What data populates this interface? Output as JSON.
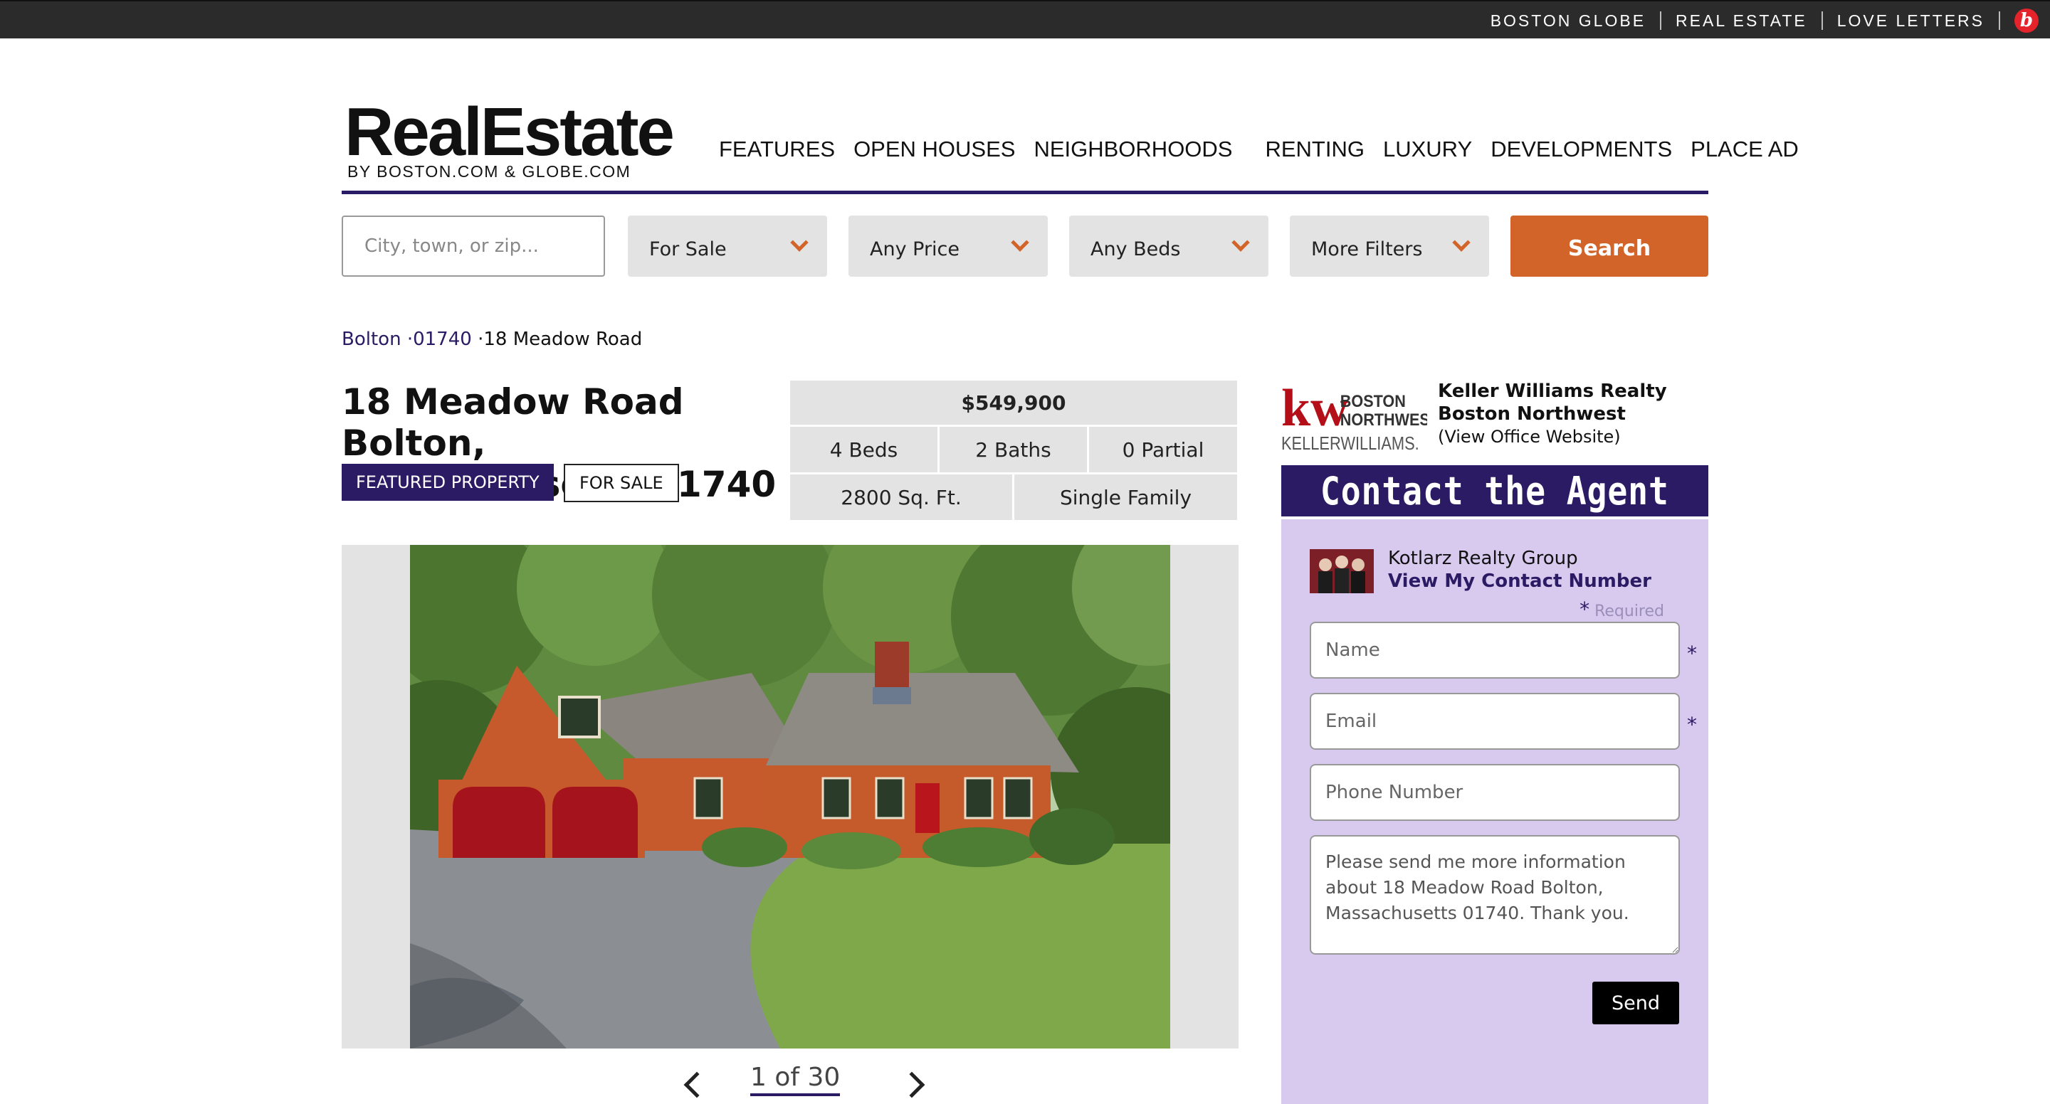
{
  "topbar": {
    "links": [
      "BOSTON GLOBE",
      "REAL ESTATE",
      "LOVE LETTERS"
    ],
    "brand_glyph": "b"
  },
  "header": {
    "logo_main": "RealEstate",
    "logo_sub": "BY BOSTON.COM & GLOBE.COM",
    "nav": [
      "FEATURES",
      "OPEN HOUSES",
      "NEIGHBORHOODS",
      "RENTING",
      "LUXURY",
      "DEVELOPMENTS",
      "PLACE AD"
    ]
  },
  "search": {
    "placeholder": "City, town, or zip...",
    "filters": [
      "For Sale",
      "Any Price",
      "Any Beds",
      "More Filters"
    ],
    "button": "Search"
  },
  "breadcrumb": {
    "town": "Bolton",
    "zip": "01740",
    "sep": "·",
    "current": "18 Meadow Road"
  },
  "property": {
    "title": "18 Meadow Road Bolton, Massachusetts 01740",
    "badge_featured": "FEATURED PROPERTY",
    "badge_status": "FOR SALE",
    "price": "$549,900",
    "beds": "4 Beds",
    "baths": "2 Baths",
    "partial": "0 Partial",
    "sqft": "2800 Sq. Ft.",
    "type": "Single Family"
  },
  "gallery": {
    "counter": "1 of 30"
  },
  "office": {
    "logo_kw": "kw",
    "logo_text1": "BOSTON",
    "logo_text2": "NORTHWEST",
    "logo_text3": "KELLERWILLIAMS.",
    "name": "Keller Williams Realty Boston Northwest",
    "link": "(View Office Website)"
  },
  "contact": {
    "heading": "Contact the Agent",
    "agent_name": "Kotlarz Realty Group",
    "agent_link": "View My Contact Number",
    "required_star": "*",
    "required_label": "Required",
    "name_placeholder": "Name",
    "email_placeholder": "Email",
    "phone_placeholder": "Phone Number",
    "message": "Please send me more information about 18 Meadow Road Bolton, Massachusetts 01740. Thank you.",
    "send": "Send"
  },
  "colors": {
    "brand_purple": "#2b1a64",
    "accent_orange": "#d2642a",
    "panel_lavender": "#d8c9ee"
  }
}
